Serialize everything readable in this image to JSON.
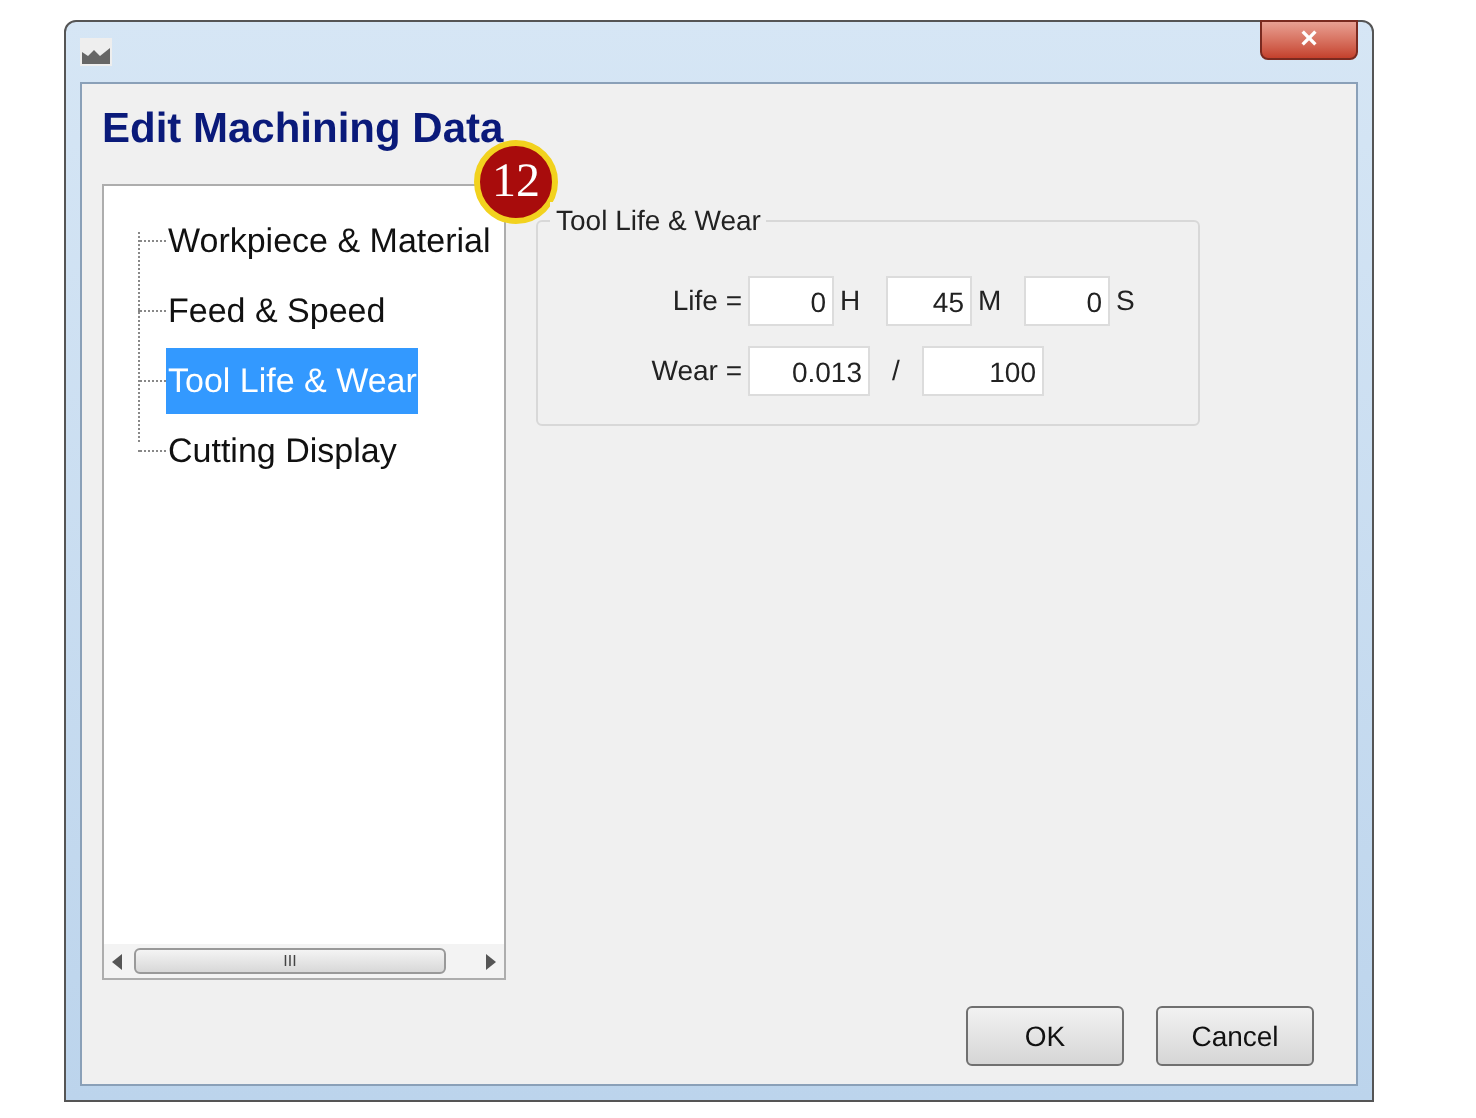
{
  "window": {
    "heading": "Edit Machining Data",
    "badge": "12",
    "close": "×"
  },
  "tree": {
    "items": [
      {
        "label": "Workpiece & Material",
        "selected": false
      },
      {
        "label": "Feed & Speed",
        "selected": false
      },
      {
        "label": "Tool Life & Wear",
        "selected": true
      },
      {
        "label": "Cutting Display",
        "selected": false
      }
    ],
    "scrollbar": {
      "grip": "III"
    }
  },
  "group": {
    "title": "Tool Life & Wear",
    "life": {
      "label": "Life =",
      "hours": "0",
      "hours_unit": "H",
      "minutes": "45",
      "minutes_unit": "M",
      "seconds": "0",
      "seconds_unit": "S"
    },
    "wear": {
      "label": "Wear =",
      "value": "0.013",
      "separator": "/",
      "max": "100"
    }
  },
  "buttons": [
    "OK",
    "Cancel"
  ]
}
